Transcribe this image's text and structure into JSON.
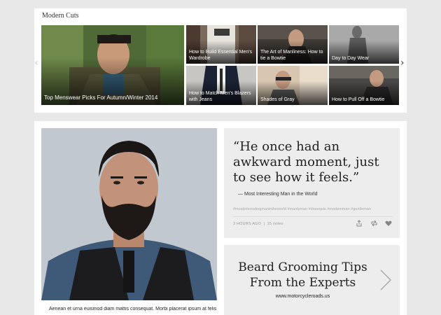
{
  "section": {
    "title": "Modern Cuts"
  },
  "featured": {
    "caption": "Top Menswear Picks For Autumn/Winter 2014"
  },
  "tiles": [
    {
      "caption": "How to Build Essential Men's Wardrobe"
    },
    {
      "caption": "The Art of Manliness: How to tie a Bowtie"
    },
    {
      "caption": "Day to Day Wear"
    },
    {
      "caption": "How to Match Men's Blazers with Jeans"
    },
    {
      "caption": "Shades of Gray"
    },
    {
      "caption": "How to Pull Off a Bowtie"
    }
  ],
  "carousel": {
    "prev_icon": "chevron-left-icon",
    "next_icon": "chevron-right-icon"
  },
  "post": {
    "caption": "Aenean et urna euismod diam mattis consequat. Morbi placerat ipsum at felis"
  },
  "quote": {
    "text": "“He once had an awkward moment, just to see how it feels.”",
    "author": "— Most Interesting Man in the World",
    "tags": "#mostinterestingmanintheworld #manlyman #dosequis #modernman #gentleman",
    "time": "3 HOURS AGO",
    "notes": "15 notes",
    "icons": [
      "share-icon",
      "reblog-icon",
      "heart-icon"
    ]
  },
  "promo": {
    "title": "Beard Grooming Tips From the Experts",
    "url": "www.motorcycleroads.us"
  },
  "colors": {
    "background": "#e8e8e8",
    "card": "#ededed",
    "caption_text": "#ffffff"
  }
}
